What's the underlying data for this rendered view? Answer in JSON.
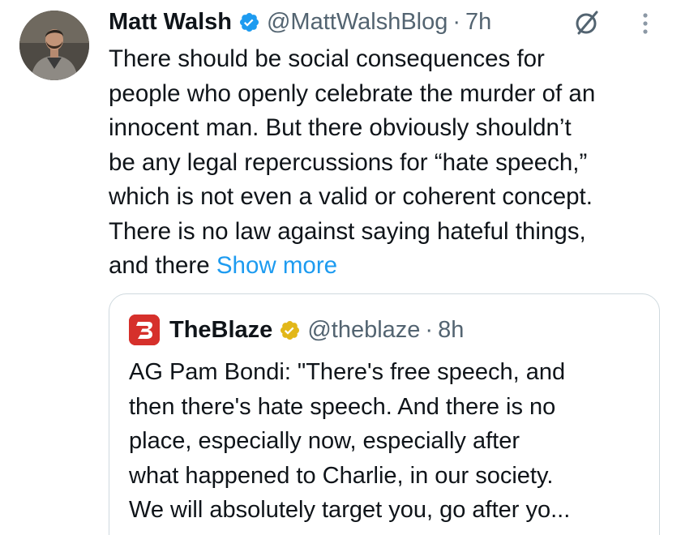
{
  "tweet": {
    "author_name": "Matt Walsh",
    "author_handle": "@MattWalshBlog",
    "separator": "·",
    "time": "7h",
    "text_lines": [
      "There should be social consequences for",
      "people who openly celebrate the murder of an",
      "innocent man. But there obviously shouldn’t",
      "be any legal repercussions for “hate speech,”",
      "which is not even a valid or coherent concept.",
      "There is no law against saying hateful things,",
      "and there "
    ],
    "show_more": "Show more"
  },
  "quoted": {
    "author_name": "TheBlaze",
    "author_handle": "@theblaze",
    "separator": "·",
    "time": "8h",
    "text_lines": [
      "AG Pam Bondi: \"There's free speech, and",
      "then there's hate speech. And there is no",
      "place, especially now, especially after",
      "what happened to Charlie, in our society.",
      "We will absolutely target you, go after yo..."
    ]
  },
  "icons": {
    "verified_blue": "verified-badge-icon",
    "verified_gold": "verified-gold-badge-icon",
    "grok": "grok-icon",
    "more": "more-vertical-icon",
    "blaze_logo": "theblaze-logo"
  },
  "colors": {
    "text": "#0f1419",
    "secondary": "#536471",
    "link": "#1d9bf0",
    "verified_blue": "#1d9bf0",
    "verified_gold": "#e2b719",
    "blaze_red": "#d6302b",
    "border": "#cfd9de"
  }
}
